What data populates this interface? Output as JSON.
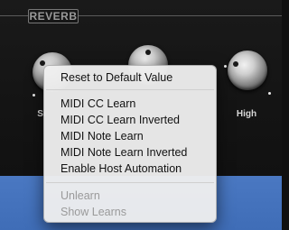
{
  "section": {
    "label": "REVERB"
  },
  "knobs": [
    {
      "label": "Si"
    },
    {
      "label": ""
    },
    {
      "label": "High"
    }
  ],
  "context_menu": {
    "items": [
      "Reset to Default Value",
      "MIDI CC Learn",
      "MIDI CC Learn Inverted",
      "MIDI Note Learn",
      "MIDI Note Learn Inverted",
      "Enable Host Automation",
      "Unlearn",
      "Show Learns"
    ]
  },
  "colors": {
    "panel": "#141414",
    "accent_blue": "#4372bd",
    "menu_bg": "#eeeeee",
    "disabled_text": "#9a9a9a"
  }
}
